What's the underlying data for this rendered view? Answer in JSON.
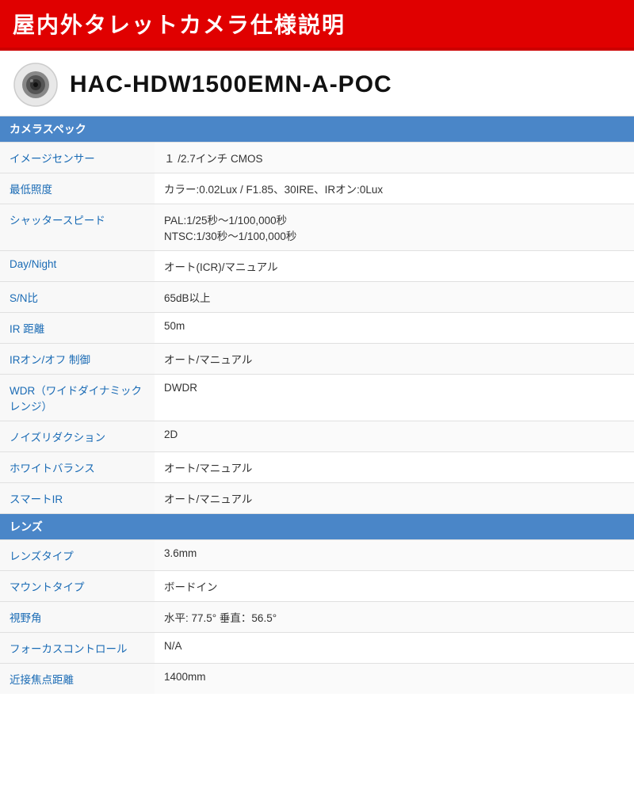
{
  "header": {
    "title": "屋内外タレットカメラ仕様説明"
  },
  "model": {
    "name": "HAC-HDW1500EMN-A-POC",
    "icon_label": "camera-icon"
  },
  "sections": [
    {
      "id": "camera-spec",
      "header": "カメラスペック",
      "rows": [
        {
          "label": "イメージセンサー",
          "value": "１ /2.7インチ CMOS"
        },
        {
          "label": "最低照度",
          "value": "カラー:0.02Lux / F1.85、30IRE、IRオン:0Lux"
        },
        {
          "label": "シャッタースピード",
          "value": "PAL:1/25秒〜1/100,000秒\nNTSC:1/30秒〜1/100,000秒"
        },
        {
          "label": "Day/Night",
          "value": "オート(ICR)/マニュアル"
        },
        {
          "label": "S/N比",
          "value": "65dB以上"
        },
        {
          "label": "IR 距離",
          "value": "50m"
        },
        {
          "label": "IRオン/オフ 制御",
          "value": "オート/マニュアル"
        },
        {
          "label": "WDR（ワイドダイナミックレンジ）",
          "value": "DWDR"
        },
        {
          "label": "ノイズリダクション",
          "value": "2D"
        },
        {
          "label": "ホワイトバランス",
          "value": "オート/マニュアル"
        },
        {
          "label": "スマートIR",
          "value": "オート/マニュアル"
        }
      ]
    },
    {
      "id": "lens",
      "header": "レンズ",
      "rows": [
        {
          "label": "レンズタイプ",
          "value": "3.6mm"
        },
        {
          "label": "マウントタイプ",
          "value": "ボードイン"
        },
        {
          "label": "視野角",
          "value": "水平: 77.5°  垂直：56.5°"
        },
        {
          "label": "フォーカスコントロール",
          "value": "N/A"
        },
        {
          "label": "近接焦点距離",
          "value": "1400mm"
        }
      ]
    }
  ]
}
